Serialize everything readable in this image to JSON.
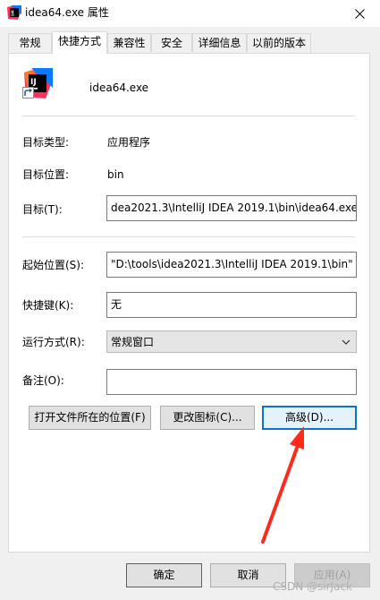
{
  "window": {
    "title": "idea64.exe 属性",
    "close_icon": "close-icon"
  },
  "tabs": [
    {
      "label": "常规"
    },
    {
      "label": "快捷方式",
      "active": true
    },
    {
      "label": "兼容性"
    },
    {
      "label": "安全"
    },
    {
      "label": "详细信息"
    },
    {
      "label": "以前的版本"
    }
  ],
  "shortcut": {
    "icon": "intellij-idea-icon",
    "name": "idea64.exe"
  },
  "fields": {
    "target_type_label": "目标类型:",
    "target_type_value": "应用程序",
    "target_location_label": "目标位置:",
    "target_location_value": "bin",
    "target_label": "目标(T):",
    "target_value": "dea2021.3\\IntelliJ IDEA 2019.1\\bin\\idea64.exe\"",
    "start_in_label": "起始位置(S):",
    "start_in_value": "\"D:\\tools\\idea2021.3\\IntelliJ IDEA 2019.1\\bin\"",
    "hotkey_label": "快捷键(K):",
    "hotkey_value": "无",
    "run_label": "运行方式(R):",
    "run_value": "常规窗口",
    "comment_label": "备注(O):",
    "comment_value": ""
  },
  "buttons": {
    "open_location": "打开文件所在的位置(F)",
    "change_icon": "更改图标(C)...",
    "advanced": "高级(D)...",
    "ok": "确定",
    "cancel": "取消",
    "apply": "应用(A)"
  },
  "watermark": "CSDN @sirJack",
  "colors": {
    "focus_border": "#0078d7",
    "annotation_arrow": "#ff2a1a"
  }
}
